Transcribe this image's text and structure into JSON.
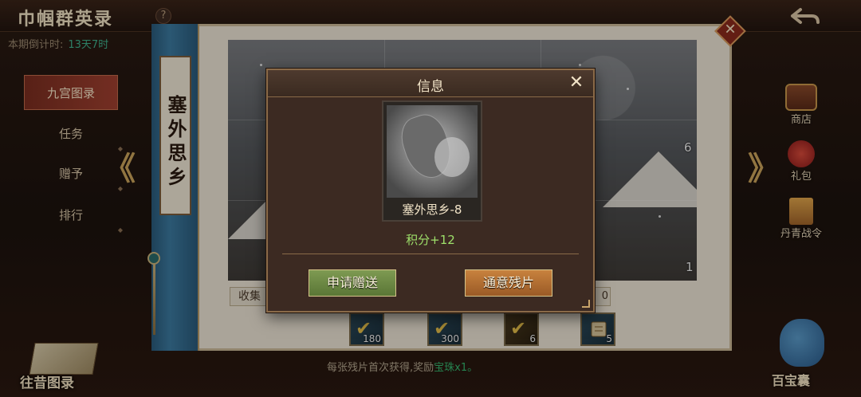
{
  "header": {
    "title": "巾帼群英录",
    "help": "?",
    "countdown_label": "本期倒计时:",
    "countdown_value": "13天7时"
  },
  "nav": {
    "items": [
      {
        "label": "九宫图录",
        "active": true
      },
      {
        "label": "任务"
      },
      {
        "label": "赠予"
      },
      {
        "label": "排行"
      }
    ]
  },
  "scroll": {
    "title": "塞外思乡"
  },
  "artwork": {
    "piece_numbers": [
      "6",
      "1"
    ]
  },
  "collect": {
    "label": "收集",
    "end_value": "0"
  },
  "rewards": [
    {
      "count": "180",
      "icon": "check-icon"
    },
    {
      "count": "300",
      "icon": "check-icon"
    },
    {
      "count": "6",
      "icon": "check-icon"
    },
    {
      "count": "5",
      "icon": "scroll-icon"
    }
  ],
  "footer": {
    "note_prefix": "每张残片首次获得,奖励",
    "note_highlight": "宝珠",
    "note_suffix": "x1。"
  },
  "side": {
    "shop": "商店",
    "gift": "礼包",
    "pass": "丹青战令",
    "treasure": "百宝囊",
    "past": "往昔图录"
  },
  "dialog": {
    "title": "信息",
    "close": "✕",
    "card_name": "塞外思乡-8",
    "score": "积分+12",
    "request_button": "申请赠送",
    "general_button": "通意残片"
  },
  "colors": {
    "accent_gold": "#caa35a",
    "score_green": "#9ee06a",
    "countdown_teal": "#3fb08c",
    "button_green": "#7e9a52",
    "button_orange": "#c8823e"
  }
}
